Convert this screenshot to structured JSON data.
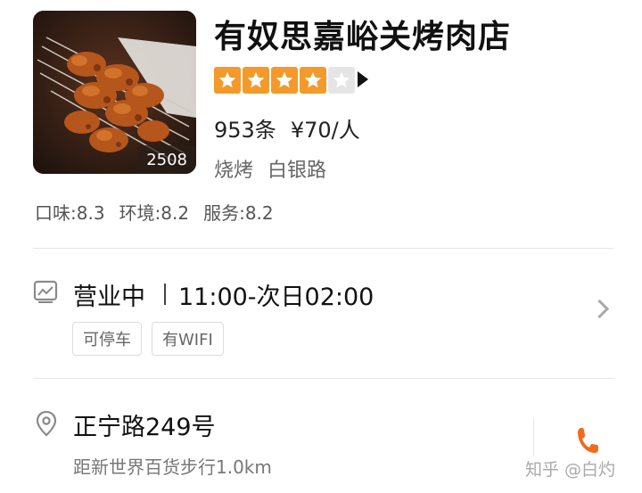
{
  "shop": {
    "name": "有奴思嘉峪关烤肉店",
    "photo_count": "2508",
    "rating_stars": 4,
    "rating_max": 5,
    "reviews": "953条",
    "price": "¥70/人",
    "category": "烧烤",
    "area": "白银路",
    "scores": {
      "taste": "口味:8.3",
      "environment": "环境:8.2",
      "service": "服务:8.2"
    }
  },
  "hours": {
    "status": "营业中",
    "time": "11:00-次日02:00",
    "tags": [
      "可停车",
      "有WIFI"
    ]
  },
  "location": {
    "address": "正宁路249号",
    "distance": "距新世界百货步行1.0km"
  },
  "watermark": "知乎 @白灼",
  "colors": {
    "star_active": "#f39a2b",
    "star_inactive": "#e5e5e5",
    "phone_icon": "#f26a1b"
  },
  "icons": {
    "hours": "shop-hours-icon",
    "location": "location-pin-icon",
    "call": "phone-icon",
    "details": "chevron-right-icon"
  }
}
